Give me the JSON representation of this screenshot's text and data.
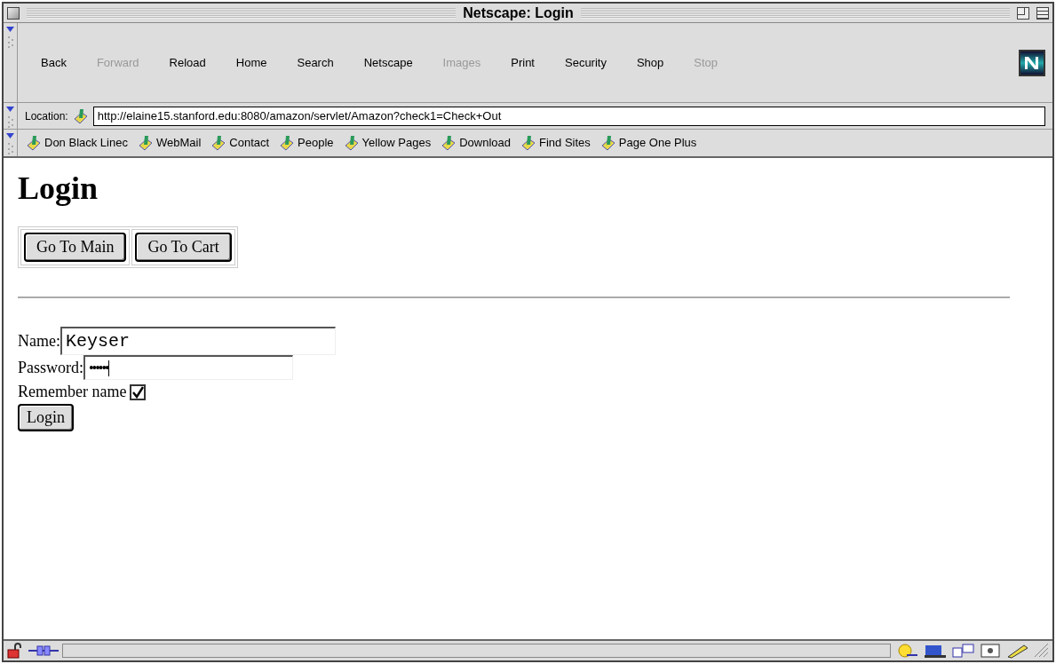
{
  "window": {
    "title": "Netscape: Login"
  },
  "nav_buttons": [
    {
      "label": "Back",
      "disabled": false
    },
    {
      "label": "Forward",
      "disabled": true
    },
    {
      "label": "Reload",
      "disabled": false
    },
    {
      "label": "Home",
      "disabled": false
    },
    {
      "label": "Search",
      "disabled": false
    },
    {
      "label": "Netscape",
      "disabled": false
    },
    {
      "label": "Images",
      "disabled": true
    },
    {
      "label": "Print",
      "disabled": false
    },
    {
      "label": "Security",
      "disabled": false
    },
    {
      "label": "Shop",
      "disabled": false
    },
    {
      "label": "Stop",
      "disabled": true
    }
  ],
  "location": {
    "label": "Location:",
    "url": "http://elaine15.stanford.edu:8080/amazon/servlet/Amazon?check1=Check+Out"
  },
  "bookmarks": [
    "Don Black Linec",
    "WebMail",
    "Contact",
    "People",
    "Yellow Pages",
    "Download",
    "Find Sites",
    "Page One Plus"
  ],
  "page": {
    "heading": "Login",
    "nav_buttons": [
      "Go To Main",
      "Go To Cart"
    ],
    "name_label": "Name:",
    "name_value": "Keyser",
    "password_label": "Password:",
    "password_value": "••••••",
    "remember_label": "Remember name",
    "remember_checked": true,
    "submit": "Login"
  }
}
